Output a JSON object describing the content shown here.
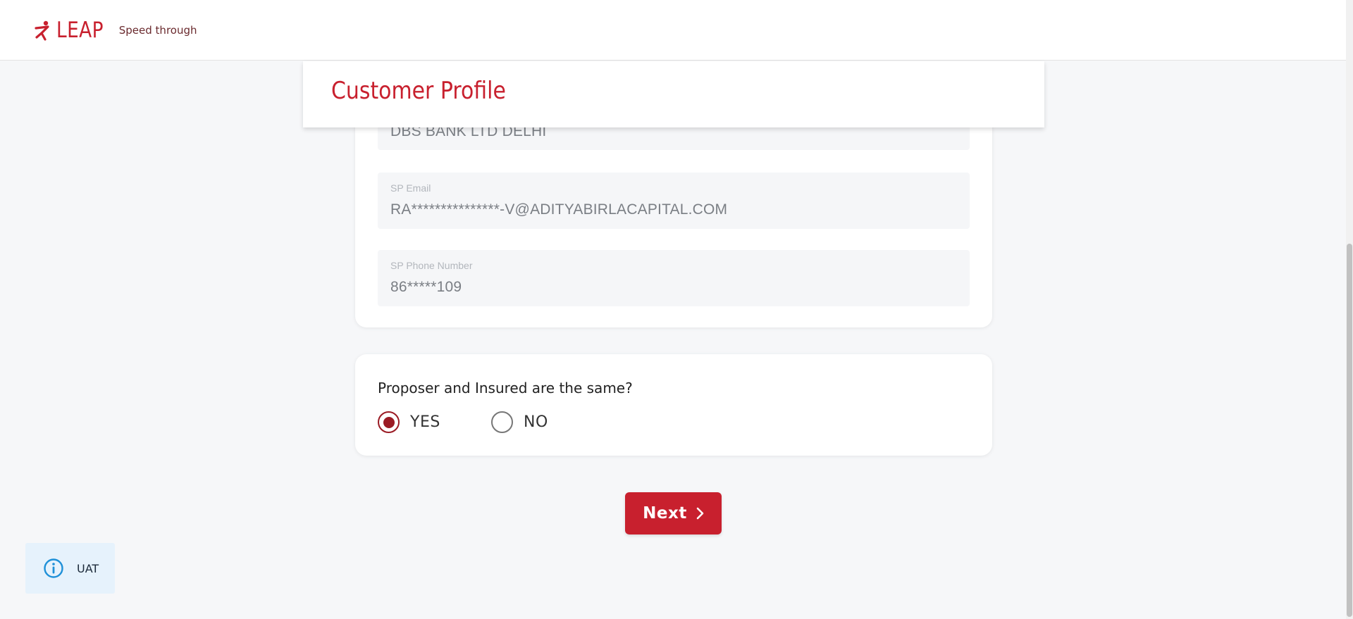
{
  "header": {
    "logo_text": "LEAP",
    "tagline": "Speed through"
  },
  "page": {
    "title": "Customer Profile"
  },
  "details": {
    "bank_value": "DBS BANK LTD DELHI",
    "sp_email_label": "SP Email",
    "sp_email_value": "RA***************-V@ADITYABIRLACAPITAL.COM",
    "sp_phone_label": "SP Phone Number",
    "sp_phone_value": "86*****109"
  },
  "question": {
    "text": "Proposer and Insured are the same?",
    "options": [
      {
        "label": "YES",
        "selected": true
      },
      {
        "label": "NO",
        "selected": false
      }
    ]
  },
  "actions": {
    "next_label": "Next"
  },
  "environment": {
    "label": "UAT"
  },
  "colors": {
    "brand": "#c8202e",
    "radio_selected": "#9b1b24",
    "badge_bg": "#e6f2fc",
    "info_icon": "#1e90d8"
  },
  "icons": {
    "logo": "running-figure-icon",
    "next": "chevron-right-icon",
    "env": "info-icon"
  }
}
